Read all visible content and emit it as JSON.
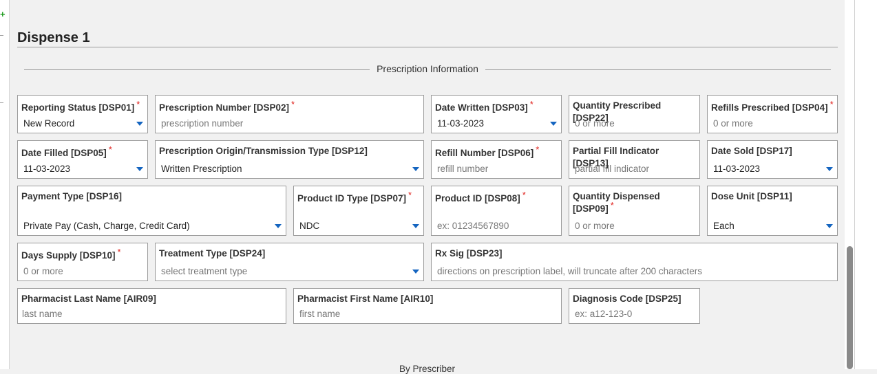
{
  "section": {
    "title": "Dispense 1",
    "legend": "Prescription Information"
  },
  "fields": {
    "dsp01": {
      "label": "Reporting Status [DSP01]",
      "value": "New Record",
      "required": "*"
    },
    "dsp02": {
      "label": "Prescription Number [DSP02]",
      "placeholder": "prescription number",
      "required": "*"
    },
    "dsp03": {
      "label": "Date Written [DSP03]",
      "value": "11-03-2023",
      "required": "*"
    },
    "dsp22": {
      "label": "Quantity Prescribed [DSP22]",
      "placeholder": "0 or more"
    },
    "dsp04": {
      "label": "Refills Prescribed [DSP04]",
      "placeholder": "0 or more",
      "required": "*"
    },
    "dsp05": {
      "label": "Date Filled [DSP05]",
      "value": "11-03-2023",
      "required": "*"
    },
    "dsp12": {
      "label": "Prescription Origin/Transmission Type [DSP12]",
      "value": "Written Prescription"
    },
    "dsp06": {
      "label": "Refill Number [DSP06]",
      "placeholder": "refill number",
      "required": "*"
    },
    "dsp13": {
      "label": "Partial Fill Indicator [DSP13]",
      "placeholder": "partial fill indicator"
    },
    "dsp17": {
      "label": "Date Sold [DSP17]",
      "value": "11-03-2023"
    },
    "dsp16": {
      "label": "Payment Type [DSP16]",
      "value": "Private Pay (Cash, Charge, Credit Card)"
    },
    "dsp07": {
      "label": "Product ID Type [DSP07]",
      "value": "NDC",
      "required": "*"
    },
    "dsp08": {
      "label": "Product ID [DSP08]",
      "placeholder": "ex: 01234567890",
      "required": "*"
    },
    "dsp09": {
      "label_line1": "Quantity Dispensed",
      "label_line2": "[DSP09]",
      "placeholder": "0 or more",
      "required": "*"
    },
    "dsp11": {
      "label": "Dose Unit [DSP11]",
      "value": "Each"
    },
    "dsp10": {
      "label": "Days Supply [DSP10]",
      "placeholder": "0 or more",
      "required": "*"
    },
    "dsp24": {
      "label": "Treatment Type [DSP24]",
      "placeholder": "select treatment type"
    },
    "dsp23": {
      "label": "Rx Sig [DSP23]",
      "placeholder": "directions on prescription label, will truncate after 200 characters"
    },
    "air09": {
      "label": "Pharmacist Last Name [AIR09]",
      "placeholder": "last name"
    },
    "air10": {
      "label": "Pharmacist First Name [AIR10]",
      "placeholder": "first name"
    },
    "dsp25": {
      "label": "Diagnosis Code [DSP25]",
      "placeholder": "ex: a12-123-0"
    }
  },
  "next_section": {
    "legend": "By Prescriber"
  },
  "colors": {
    "required": "#e0201b",
    "caret": "#1565c0",
    "border": "#9b9b9b"
  },
  "icons": {
    "dropdown": "chevron-down-icon",
    "add": "plus-icon"
  }
}
